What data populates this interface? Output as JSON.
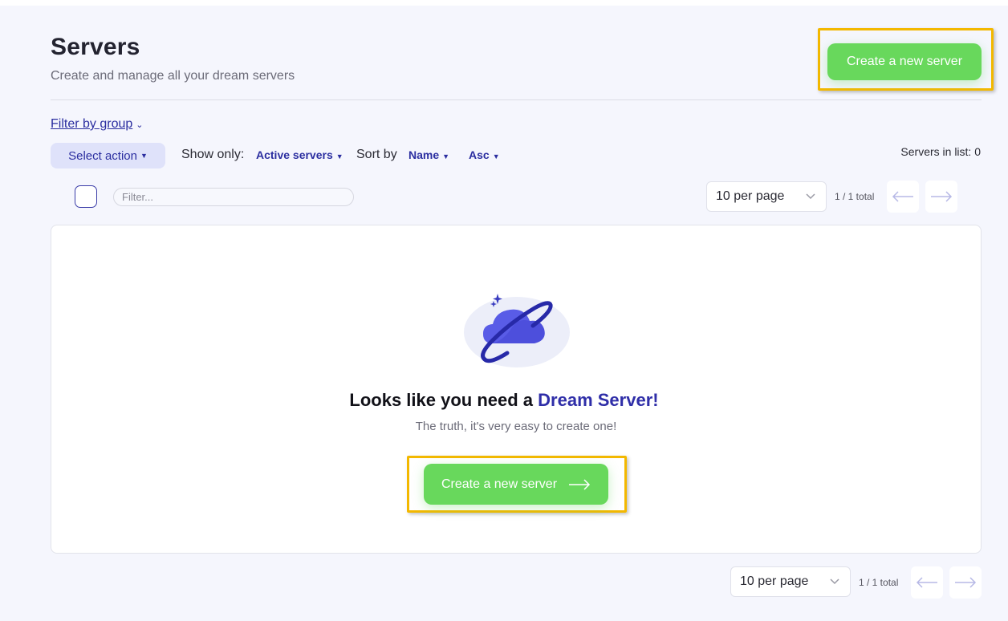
{
  "header": {
    "title": "Servers",
    "subtitle": "Create and manage all your dream servers",
    "create_button_label": "Create a new server"
  },
  "toolbar": {
    "filter_group_label": "Filter by group",
    "select_action_label": "Select action",
    "show_only_label": "Show only:",
    "show_only_value": "Active servers",
    "sort_by_label": "Sort by",
    "sort_by_value": "Name",
    "sort_order_value": "Asc",
    "servers_in_list_label": "Servers in list: 0"
  },
  "list_controls": {
    "filter_placeholder": "Filter...",
    "per_page_value": "10 per page",
    "pagination_text": "1 / 1 total"
  },
  "empty_state": {
    "heading_prefix": "Looks like you need a",
    "heading_accent": "Dream Server!",
    "subtext": "The truth, it's very easy to create one!",
    "button_label": "Create a new server"
  },
  "bottom_controls": {
    "per_page_value": "10 per page",
    "pagination_text": "1 / 1 total"
  },
  "icons": {
    "prev": "arrow-left-icon",
    "next": "arrow-right-icon",
    "dropdown": "chevron-down-icon",
    "illustration": "cloud-planet-illustration"
  },
  "colors": {
    "accent": "#2b2ea0",
    "primary_green": "#68d85c",
    "highlight": "#f3b800",
    "background": "#f5f6fd"
  }
}
